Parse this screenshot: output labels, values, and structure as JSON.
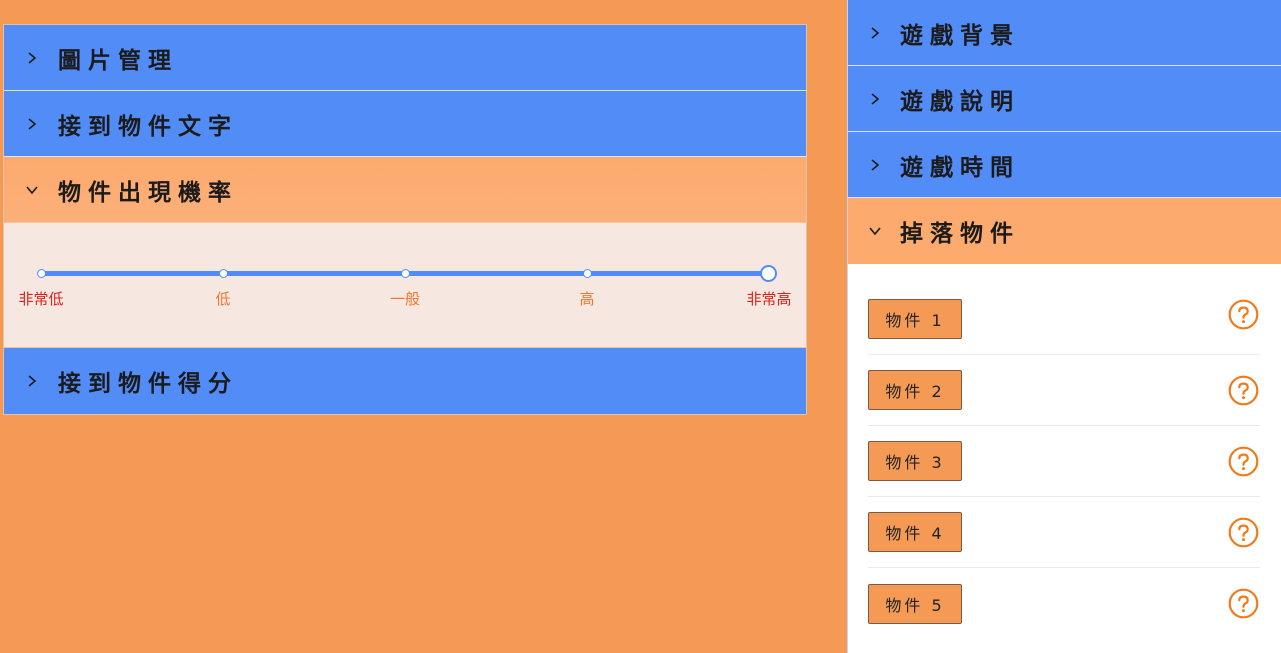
{
  "left": {
    "sections": [
      {
        "title": "圖片管理",
        "state": "collapsed"
      },
      {
        "title": "接到物件文字",
        "state": "collapsed"
      },
      {
        "title": "物件出現機率",
        "state": "expanded"
      },
      {
        "title": "接到物件得分",
        "state": "collapsed"
      }
    ],
    "slider": {
      "labels": [
        "非常低",
        "低",
        "一般",
        "高",
        "非常高"
      ],
      "selected_index": 4
    }
  },
  "right": {
    "sections": [
      {
        "title": "遊戲背景",
        "state": "collapsed"
      },
      {
        "title": "遊戲說明",
        "state": "collapsed"
      },
      {
        "title": "遊戲時間",
        "state": "collapsed"
      },
      {
        "title": "掉落物件",
        "state": "expanded"
      }
    ],
    "items": [
      {
        "label": "物件 1",
        "help_icon": "help-circle-icon"
      },
      {
        "label": "物件 2",
        "help_icon": "help-circle-icon"
      },
      {
        "label": "物件 3",
        "help_icon": "help-circle-icon"
      },
      {
        "label": "物件 4",
        "help_icon": "help-circle-icon"
      },
      {
        "label": "物件 5",
        "help_icon": "help-circle-icon"
      }
    ]
  },
  "colors": {
    "background": "#f59a55",
    "header_collapsed": "#528cf7",
    "header_expanded": "#fdaa6e",
    "slider_track": "#528cf7",
    "label_active": "#e0201a",
    "label_normal": "#f07830",
    "help_icon": "#f07a1a"
  }
}
